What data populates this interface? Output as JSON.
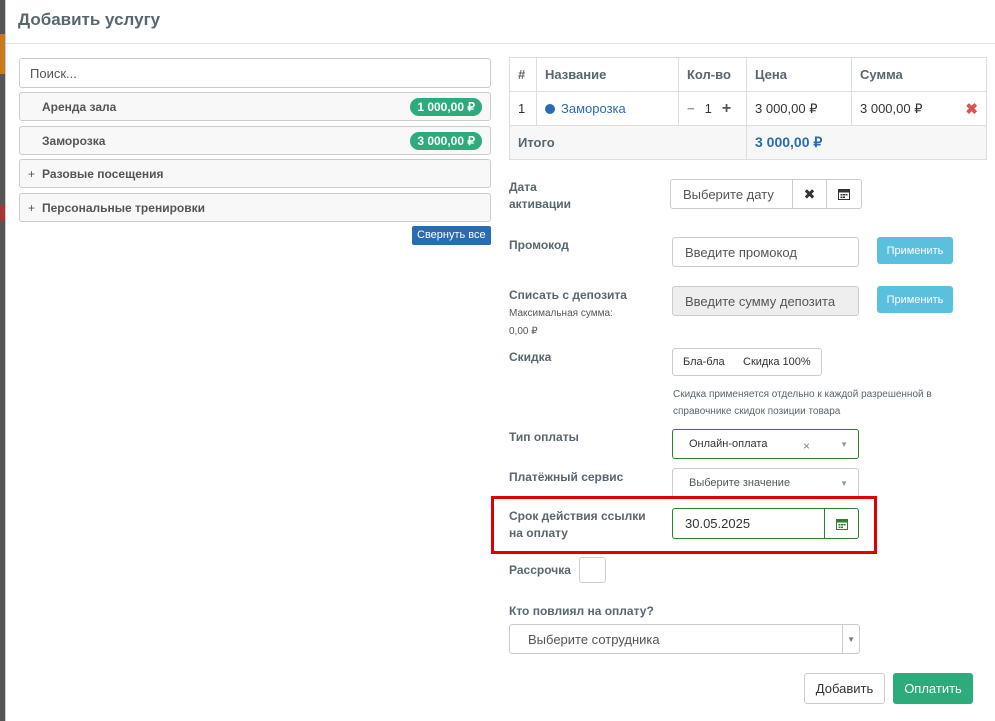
{
  "modal": {
    "title": "Добавить услугу"
  },
  "catalog": {
    "search_placeholder": "Поиск...",
    "items": [
      {
        "label": "Аренда зала",
        "price": "1 000,00 ₽"
      },
      {
        "label": "Заморозка",
        "price": "3 000,00 ₽"
      }
    ],
    "groups": [
      {
        "icon": "+",
        "label": "Разовые посещения"
      },
      {
        "icon": "+",
        "label": "Персональные тренировки"
      }
    ],
    "collapse_all": "Свернуть все"
  },
  "cart": {
    "headers": [
      "#",
      "Название",
      "Кол-во",
      "Цена",
      "Сумма"
    ],
    "rows": [
      {
        "num": "1",
        "name": "Заморозка",
        "qty_minus": "−",
        "qty": "1",
        "qty_plus": "+",
        "price": "3 000,00 ₽",
        "sum": "3 000,00 ₽",
        "remove": "✖"
      }
    ],
    "total_label": "Итого",
    "total_value": "3 000,00 ₽"
  },
  "form": {
    "activation_label_1": "Дата",
    "activation_label_2": "активации",
    "activation_placeholder": "Выберите дату",
    "clear_icon": "✖",
    "promo_label": "Промокод",
    "promo_placeholder": "Введите промокод",
    "apply": "Применить",
    "deposit_label": "Списать с депозита",
    "deposit_max_label": "Максимальная сумма:",
    "deposit_max_value": "0,00 ₽",
    "deposit_placeholder": "Введите сумму депозита",
    "discount_label": "Скидка",
    "discount_options": [
      "Бла-бла",
      "Скидка 100%"
    ],
    "discount_hint": "Скидка применяется отдельно к каждой разрешенной в справочнике скидок позиции товара",
    "payment_type_label": "Тип оплаты",
    "payment_type_value": "Онлайн-оплата",
    "payment_service_label": "Платёжный сервис",
    "payment_service_placeholder": "Выберите значение",
    "link_expiry_label_1": "Срок действия ссылки",
    "link_expiry_label_2": "на оплату",
    "link_expiry_value": "30.05.2025",
    "installment_label": "Рассрочка",
    "influencer_label": "Кто повлиял на оплату?",
    "influencer_placeholder": "Выберите сотрудника",
    "add_button": "Добавить",
    "pay_button": "Оплатить"
  },
  "colors": {
    "accent": "#2a6bb3",
    "success": "#2dab7b",
    "info": "#5bc0de",
    "danger": "#d9534f",
    "highlight": "#e00000"
  }
}
